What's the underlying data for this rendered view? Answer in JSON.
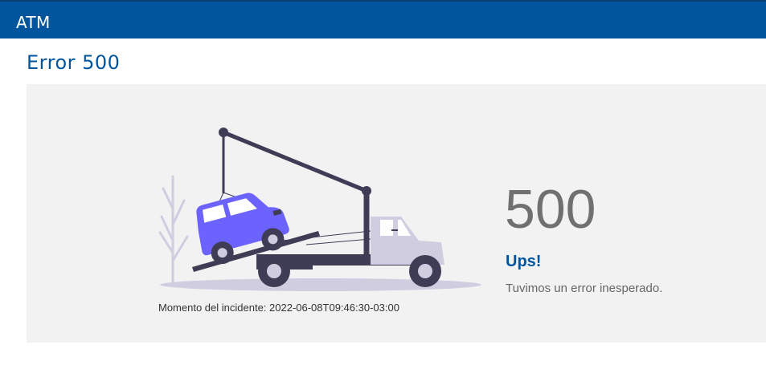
{
  "header": {
    "app_title": "ATM"
  },
  "page": {
    "title": "Error 500"
  },
  "error": {
    "code": "500",
    "headline": "Ups!",
    "message": "Tuvimos un error inesperado.",
    "incident": "Momento del incidente: 2022-06-08T09:46:30-03:00"
  },
  "illustration": {
    "icon": "tow-truck-illustration",
    "colors": {
      "dark": "#3f3d56",
      "car": "#6c63ff",
      "truck_cab": "#d0cde1",
      "ground": "#d0cde1",
      "plant": "#d0cde1"
    }
  },
  "theme": {
    "brand": "#00559c",
    "panel": "#f2f2f2"
  }
}
